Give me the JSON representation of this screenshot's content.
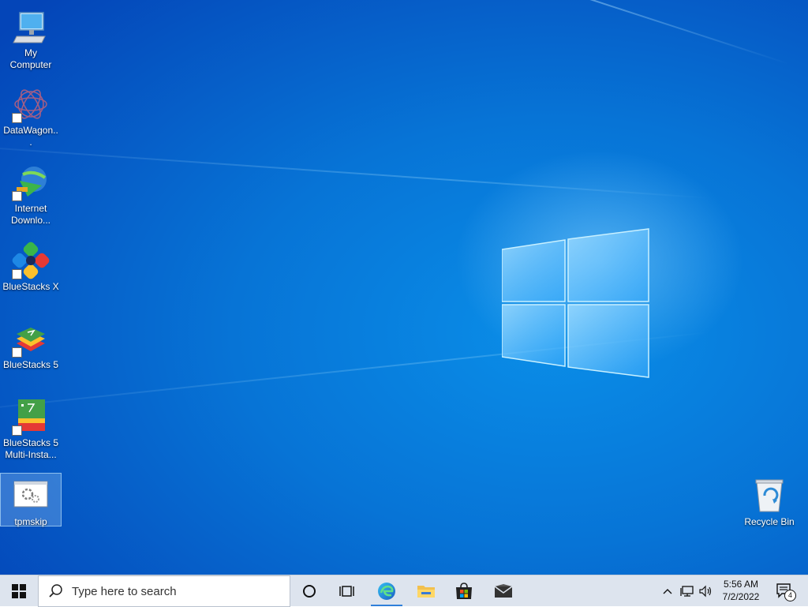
{
  "desktop": {
    "icons": [
      {
        "label": "My Computer",
        "icon": "computer-icon",
        "shortcut": false
      },
      {
        "label": "DataWagon...",
        "icon": "datawagon-icon",
        "shortcut": true
      },
      {
        "label": "Internet Downlo...",
        "icon": "internet-download-manager-icon",
        "shortcut": true
      },
      {
        "label": "BlueStacks X",
        "icon": "bluestacks-x-icon",
        "shortcut": true
      },
      {
        "label": "BlueStacks 5",
        "icon": "bluestacks-5-icon",
        "shortcut": true
      },
      {
        "label": "BlueStacks 5 Multi-Insta...",
        "icon": "bluestacks-multi-instance-icon",
        "shortcut": true
      },
      {
        "label": "tpmskip",
        "icon": "settings-app-icon",
        "shortcut": false,
        "selected": true
      }
    ],
    "recycle_bin": {
      "label": "Recycle Bin",
      "icon": "recycle-bin-icon"
    }
  },
  "taskbar": {
    "start_icon": "windows-start-icon",
    "search_placeholder": "Type here to search",
    "pinned": [
      {
        "name": "cortana",
        "icon": "cortana-icon"
      },
      {
        "name": "task-view",
        "icon": "task-view-icon"
      },
      {
        "name": "edge",
        "icon": "edge-icon",
        "active": true
      },
      {
        "name": "file-explorer",
        "icon": "folder-icon"
      },
      {
        "name": "store",
        "icon": "store-icon"
      },
      {
        "name": "mail",
        "icon": "mail-icon"
      }
    ],
    "tray": {
      "time": "5:56 AM",
      "date": "7/2/2022",
      "notification_count": "4"
    }
  },
  "colors": {
    "desktop_dark": "#0445b8",
    "desktop_light": "#0a8ee8",
    "taskbar": "#dde4ee",
    "accent": "#2f7fd9"
  }
}
